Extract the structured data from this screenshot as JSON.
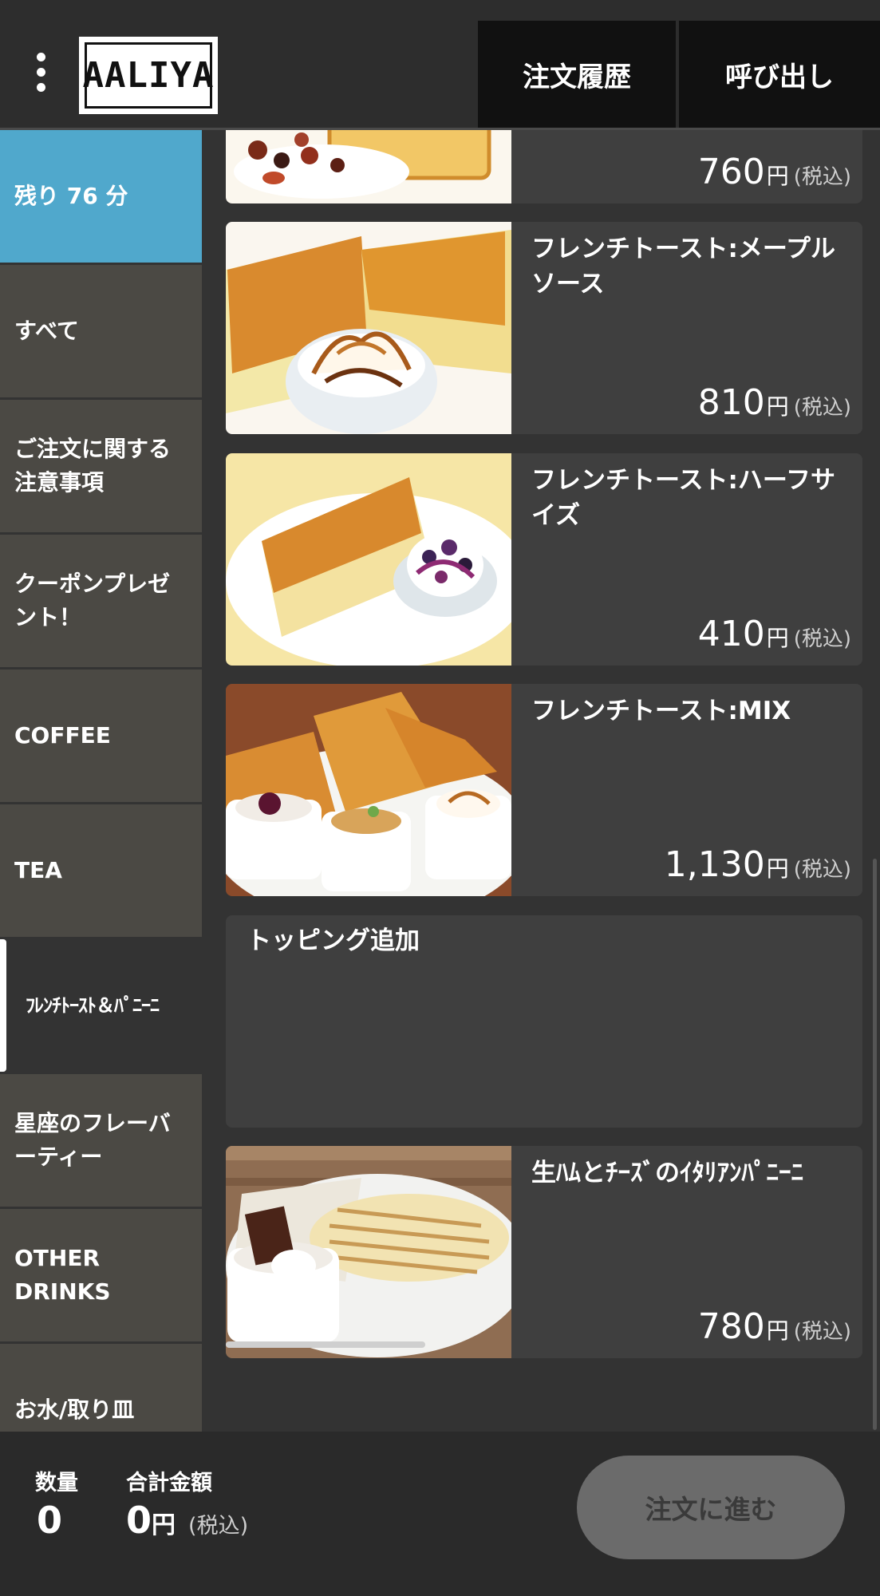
{
  "header": {
    "logo_text": "AALIYA",
    "history_label": "注文履歴",
    "call_label": "呼び出し"
  },
  "sidebar": {
    "timer": "残り 76 分",
    "items": [
      {
        "label": "すべて"
      },
      {
        "label": "ご注文に関する注意事項"
      },
      {
        "label": "クーポンプレゼント！"
      },
      {
        "label": "COFFEE"
      },
      {
        "label": "TEA"
      },
      {
        "label": "ﾌﾚﾝﾁﾄｰｽﾄ＆ﾊﾟﾆｰﾆ",
        "active": true
      },
      {
        "label": "星座のフレーバーティー"
      },
      {
        "label": "OTHER DRINKS"
      },
      {
        "label": "お水/取り皿"
      }
    ]
  },
  "menu": {
    "yen": "円",
    "tax": "(税込)",
    "items": [
      {
        "name": "",
        "price": "760"
      },
      {
        "name": "フレンチトースト:メープルソース",
        "price": "810"
      },
      {
        "name": "フレンチトースト:ハーフサイズ",
        "price": "410"
      },
      {
        "name": "フレンチトースト:MIX",
        "price": "1,130"
      },
      {
        "name": "生ﾊﾑとﾁｰｽﾞのｲﾀﾘｱﾝﾊﾟﾆｰﾆ",
        "price": "780"
      }
    ],
    "section_title": "トッピング追加"
  },
  "footer": {
    "qty_label": "数量",
    "qty_value": "0",
    "total_label": "合計金額",
    "total_value": "0",
    "order_label": "注文に進む"
  },
  "colors": {
    "timer_bg": "#50a8cc",
    "sidebar_bg": "#4b4944",
    "card_bg": "#3f3f3f",
    "order_button_disabled": "#6b6b6b"
  }
}
